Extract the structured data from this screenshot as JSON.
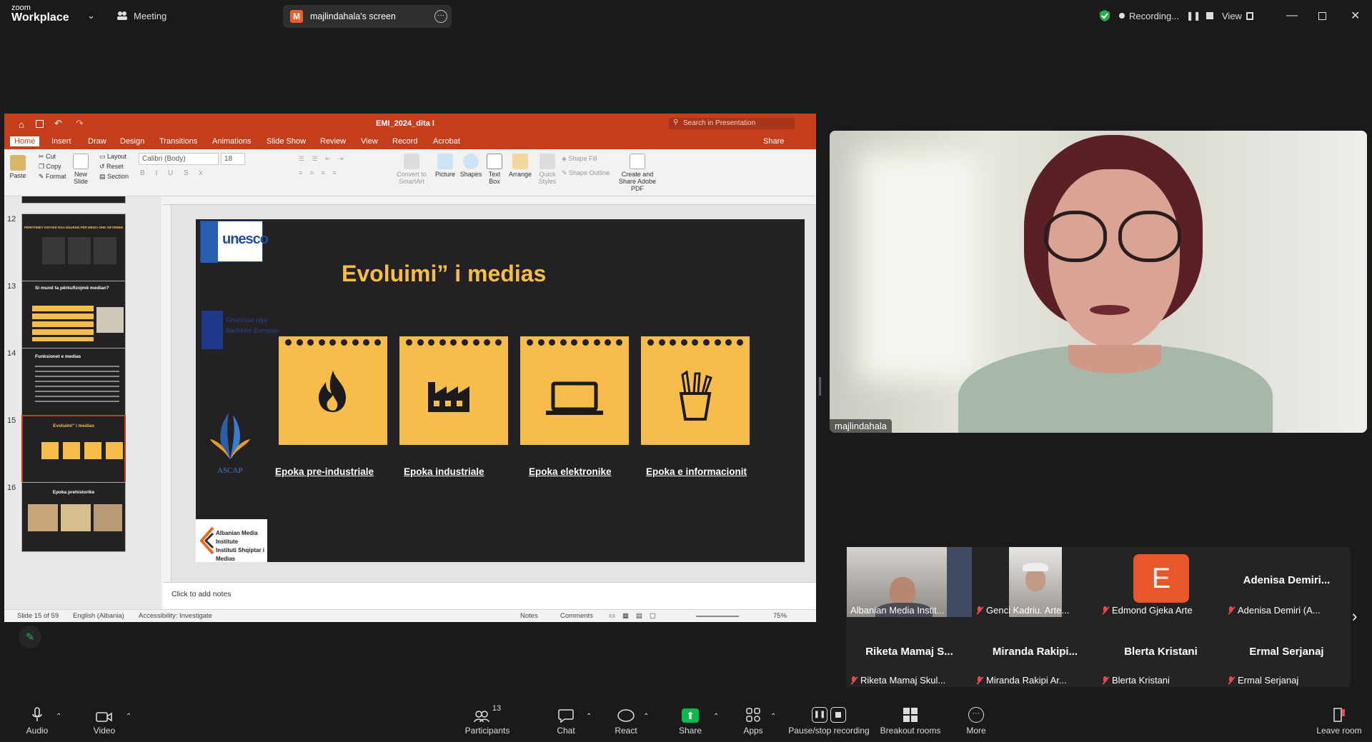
{
  "topbar": {
    "brand_line1": "zoom",
    "brand_line2": "Workplace",
    "meeting_label": "Meeting",
    "screen_badge": "M",
    "screen_label": "majlindahala's screen",
    "recording_label": "Recording...",
    "view_label": "View"
  },
  "ppt": {
    "filename": "EMI_2024_dita I",
    "search_placeholder": "Search in Presentation",
    "share_label": "Share",
    "tabs": [
      "Home",
      "Insert",
      "Draw",
      "Design",
      "Transitions",
      "Animations",
      "Slide Show",
      "Review",
      "View",
      "Record",
      "Acrobat"
    ],
    "ribbon": {
      "paste": "Paste",
      "cut": "Cut",
      "copy": "Copy",
      "format": "Format",
      "new_slide": "New Slide",
      "layout": "Layout",
      "reset": "Reset",
      "section": "Section",
      "font_name": "Calibri (Body)",
      "font_size": "18",
      "convert": "Convert to SmartArt",
      "picture": "Picture",
      "shapes": "Shapes",
      "textbox": "Text Box",
      "arrange": "Arrange",
      "quick_styles": "Quick Styles",
      "shape_fill": "Shape Fill",
      "shape_outline": "Shape Outline",
      "create_share": "Create and Share Adobe PDF"
    },
    "thumbnails": [
      {
        "num": "12",
        "title": "PËRFITIMET KRITIKE NGA EDUKIMI PËR MEDIA DHE INFORMIM"
      },
      {
        "num": "13",
        "title": "Si mund ta përkufizojmë median?"
      },
      {
        "num": "14",
        "title": "Funksionet e medias"
      },
      {
        "num": "15",
        "title": "Evoluimi\" i medias"
      },
      {
        "num": "16",
        "title": "Epoka prehistorike"
      }
    ],
    "slide": {
      "title": "Evoluimi” i medias",
      "logo_unesco": "unesco",
      "logo_eu_line1": "Financuar nga",
      "logo_eu_line2": "Bashkimi Evropian",
      "logo_ascap": "ASCAP",
      "logo_ami_line1": "Albanian Media Institute",
      "logo_ami_line2": "Instituti Shqiptar i Medias",
      "cards": [
        {
          "label": "Epoka pre-industriale",
          "icon": "fire-icon"
        },
        {
          "label": "Epoka industriale",
          "icon": "factory-icon"
        },
        {
          "label": "Epoka elektronike",
          "icon": "laptop-icon"
        },
        {
          "label": "Epoka e informacionit",
          "icon": "pencil-cup-icon"
        }
      ]
    },
    "notes_placeholder": "Click to add notes",
    "status": {
      "slide": "Slide 15 of 59",
      "language": "English (Albania)",
      "accessibility": "Accessibility: Investigate",
      "notes": "Notes",
      "comments": "Comments",
      "zoom": "75%"
    }
  },
  "participants": {
    "main_name": "majlindahala",
    "tiles": [
      {
        "name": "Albanian Media Instit...",
        "muted": false
      },
      {
        "name": "Genci Kadriu. Arte...",
        "muted": true
      },
      {
        "name": "Edmond Gjeka Arte",
        "muted": true,
        "initial": "E"
      },
      {
        "name": "Adenisa Demiri (A...",
        "muted": true,
        "big": "Adenisa  Demiri..."
      },
      {
        "name": "Riketa Mamaj Skul...",
        "muted": true,
        "big": "Riketa  Mamaj  S..."
      },
      {
        "name": "Miranda Rakipi Ar...",
        "muted": true,
        "big": "Miranda  Rakipi..."
      },
      {
        "name": "Blerta Kristani",
        "muted": true,
        "big": "Blerta Kristani"
      },
      {
        "name": "Ermal Serjanaj",
        "muted": true,
        "big": "Ermal Serjanaj"
      }
    ]
  },
  "toolbar": {
    "audio": "Audio",
    "video": "Video",
    "participants": "Participants",
    "participants_count": "13",
    "chat": "Chat",
    "react": "React",
    "share": "Share",
    "apps": "Apps",
    "record": "Pause/stop recording",
    "breakout": "Breakout rooms",
    "more": "More",
    "leave": "Leave room"
  },
  "colors": {
    "ppt_accent": "#c43e1c",
    "slide_bg": "#242124",
    "card": "#f7bd4b",
    "title": "#f7bd4b",
    "share_green": "#0fb84c",
    "edmond_avatar": "#e8562a"
  }
}
